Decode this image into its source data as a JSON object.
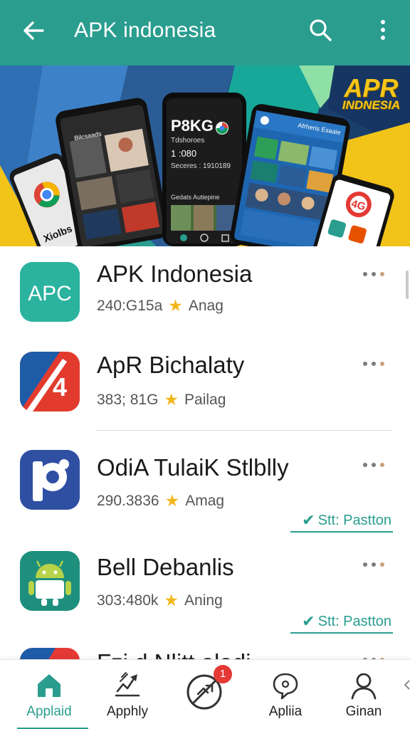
{
  "app_bar": {
    "title": "APK indonesia",
    "back_icon": "arrow-back-icon",
    "search_icon": "search-icon",
    "more_icon": "more-vert-icon",
    "background": "#2a9d8f"
  },
  "banner": {
    "logo_line1": "APR",
    "logo_line2": "INDNESIA",
    "phone_center_title": "P8KG",
    "phone_center_sub": "Tdshoroes",
    "phone_center_line1": "1 :080",
    "phone_center_line2": "Seceres : 1910189",
    "phone_center_section": "Gedats Autiepine",
    "phone_right_title": "Afrheris Esaaie",
    "phone_left_title": "Bilcsaads",
    "phone_left_bottom": "Xiolbs"
  },
  "apps": [
    {
      "name": "APK Indonesia",
      "size": "240:G15a",
      "rating_label": "Anag",
      "icon": "apc-app-icon",
      "icon_text": "APC",
      "status": ""
    },
    {
      "name": "ApR Bichalaty",
      "size": "383; 81G",
      "rating_label": "Pailag",
      "icon": "four-app-icon",
      "icon_text": "4",
      "status": ""
    },
    {
      "name": "OdiA TulaiK Stlblly",
      "size": "290.3836",
      "rating_label": "Amag",
      "icon": "p-app-icon",
      "icon_text": "",
      "status": "Stt: Pastton"
    },
    {
      "name": "Bell Debanlis",
      "size": "303:480k",
      "rating_label": "Aning",
      "icon": "android-app-icon",
      "icon_text": "",
      "status": "Stt: Pastton"
    },
    {
      "name": "Fzi d Nlitt aladi",
      "size": "",
      "rating_label": "",
      "icon": "partial-app-icon",
      "icon_text": "",
      "status": ""
    }
  ],
  "bottom_nav": [
    {
      "label": "Applaid",
      "icon": "home-icon",
      "active": true
    },
    {
      "label": "Apphly",
      "icon": "chart-edit-icon",
      "active": false
    },
    {
      "label": "",
      "icon": "blocked-apps-icon",
      "active": false,
      "badge": "1"
    },
    {
      "label": "Apliia",
      "icon": "chat-bubble-icon",
      "active": false
    },
    {
      "label": "Ginan",
      "icon": "person-icon",
      "active": false
    }
  ],
  "colors": {
    "accent": "#2a9d8f",
    "star": "#f2b61d",
    "badge": "#e53935"
  }
}
